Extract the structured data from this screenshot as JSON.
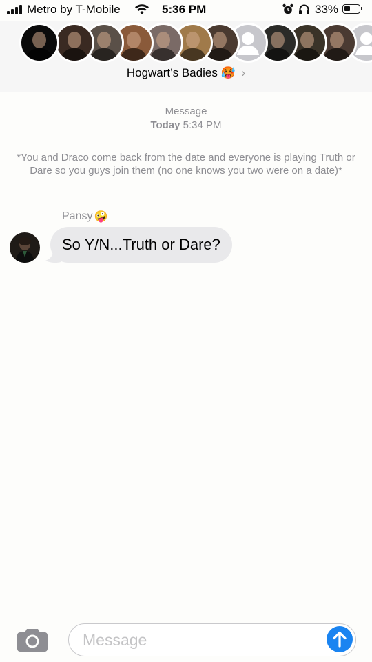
{
  "status_bar": {
    "carrier": "Metro by T-Mobile",
    "time": "5:36 PM",
    "battery": "33%",
    "icons": [
      "signal-icon",
      "wifi-icon",
      "alarm-icon",
      "headphones-icon",
      "battery-icon"
    ]
  },
  "header": {
    "group_name": "Hogwart’s Badies",
    "group_emoji": "🥵",
    "chevron": "›",
    "participants": [
      {
        "name": "participant-avatar-1",
        "color": "#0b0b0b"
      },
      {
        "name": "participant-avatar-2",
        "color": "#3a2a22"
      },
      {
        "name": "participant-avatar-3",
        "color": "#5a5048"
      },
      {
        "name": "participant-avatar-4",
        "color": "#8a5a3a"
      },
      {
        "name": "participant-avatar-5",
        "color": "#7a6a66"
      },
      {
        "name": "participant-avatar-6",
        "color": "#a07a4a"
      },
      {
        "name": "participant-avatar-7",
        "color": "#4a3a30"
      },
      {
        "name": "participant-avatar-8",
        "color": "#c7c7cc"
      },
      {
        "name": "participant-avatar-9",
        "color": "#2b2b28"
      },
      {
        "name": "participant-avatar-10",
        "color": "#3a3328"
      },
      {
        "name": "participant-avatar-11",
        "color": "#4a3a32"
      },
      {
        "name": "participant-avatar-12",
        "color": "#c7c7cc"
      }
    ]
  },
  "conversation": {
    "timestamp_label": "Message",
    "timestamp_day": "Today",
    "timestamp_time": "5:34 PM",
    "narration": "*You and Draco come back from the date and everyone is playing Truth or Dare so you guys join them (no one knows you two were on a date)*",
    "messages": [
      {
        "sender": "Pansy",
        "sender_emoji": "🤪",
        "text": "So Y/N...Truth or Dare?"
      }
    ]
  },
  "compose": {
    "placeholder": "Message"
  },
  "colors": {
    "accent": "#1a84f1",
    "bubble_incoming": "#e9e9eb",
    "secondary_text": "#8e8e93",
    "background": "#fdfdfb"
  }
}
